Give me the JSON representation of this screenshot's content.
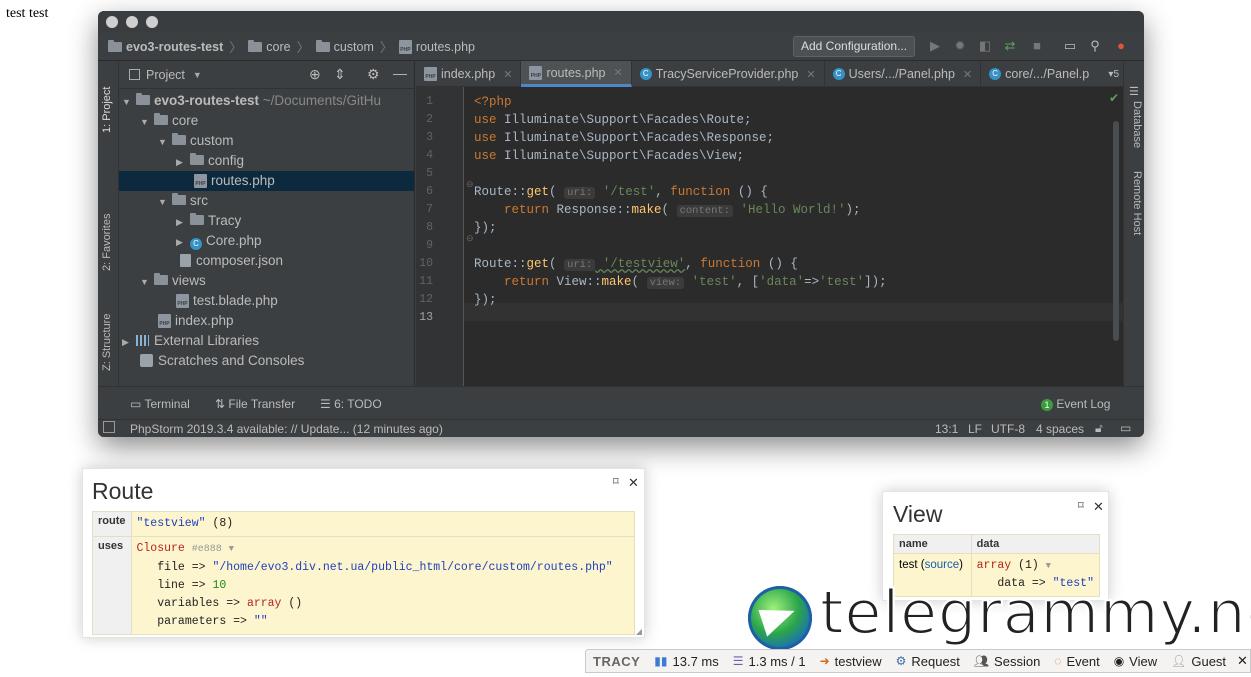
{
  "page": {
    "body_text": "test test"
  },
  "ide": {
    "nav": {
      "crumbs": [
        "evo3-routes-test",
        "core",
        "custom",
        "routes.php"
      ],
      "add_config_label": "Add Configuration..."
    },
    "left_tabs": [
      "1: Project",
      "2: Favorites",
      "Z: Structure"
    ],
    "right_tabs": [
      "Database",
      "Remote Host"
    ],
    "project": {
      "header_label": "Project",
      "tree": [
        {
          "label": "evo3-routes-test",
          "suffix": " ~/Documents/GitHu",
          "arrow": "▼",
          "icon": "folder"
        },
        {
          "label": "core",
          "arrow": "▼",
          "icon": "folder"
        },
        {
          "label": "custom",
          "arrow": "▼",
          "icon": "folder"
        },
        {
          "label": "config",
          "arrow": "▶",
          "icon": "folder"
        },
        {
          "label": "routes.php",
          "arrow": "",
          "icon": "php",
          "selected": true
        },
        {
          "label": "src",
          "arrow": "▼",
          "icon": "folder"
        },
        {
          "label": "Tracy",
          "arrow": "▶",
          "icon": "folder"
        },
        {
          "label": "Core.php",
          "arrow": "▶",
          "icon": "class"
        },
        {
          "label": "composer.json",
          "arrow": "",
          "icon": "doc"
        },
        {
          "label": "views",
          "arrow": "▼",
          "icon": "folder"
        },
        {
          "label": "test.blade.php",
          "arrow": "",
          "icon": "php"
        },
        {
          "label": "index.php",
          "arrow": "",
          "icon": "php"
        },
        {
          "label": "External Libraries",
          "arrow": "▶",
          "icon": "lib"
        },
        {
          "label": "Scratches and Consoles",
          "arrow": "",
          "icon": "scratch"
        }
      ]
    },
    "tabs": [
      {
        "label": "index.php",
        "icon": "php"
      },
      {
        "label": "routes.php",
        "icon": "php",
        "active": true
      },
      {
        "label": "TracyServiceProvider.php",
        "icon": "class"
      },
      {
        "label": "Users/.../Panel.php",
        "icon": "class"
      },
      {
        "label": "core/.../Panel.p",
        "icon": "class"
      }
    ],
    "tabs_overflow": "5",
    "line_numbers": [
      "1",
      "2",
      "3",
      "4",
      "5",
      "6",
      "7",
      "8",
      "9",
      "10",
      "11",
      "12",
      "13"
    ],
    "code": {
      "l1": "<?php",
      "l2_kw": "use",
      "l2": " Illuminate\\Support\\Facades\\Route;",
      "l3_kw": "use",
      "l3": " Illuminate\\Support\\Facades\\Response;",
      "l4_kw": "use",
      "l4": " Illuminate\\Support\\Facades\\View;",
      "l6_a": "Route::",
      "l6_fn": "get",
      "l6_b": "( ",
      "l6_hint": "uri:",
      "l6_str": " '/test'",
      "l6_c": ", ",
      "l6_kw": "function",
      "l6_d": " () {",
      "l7_kw": "    return",
      "l7_a": " Response::",
      "l7_fn": "make",
      "l7_b": "( ",
      "l7_hint": "content:",
      "l7_str": " 'Hello World!'",
      "l7_c": ");",
      "l8": "});",
      "l10_a": "Route::",
      "l10_fn": "get",
      "l10_b": "( ",
      "l10_hint": "uri:",
      "l10_str": " '/testview'",
      "l10_c": ", ",
      "l10_kw": "function",
      "l10_d": " () {",
      "l11_kw": "    return",
      "l11_a": " View::",
      "l11_fn": "make",
      "l11_b": "( ",
      "l11_hint": "view:",
      "l11_str": " 'test'",
      "l11_c": ", [",
      "l11_str2": "'data'",
      "l11_d": "=>",
      "l11_str3": "'test'",
      "l11_e": "]);",
      "l12": "});"
    },
    "bottom_tools": [
      "Terminal",
      "File Transfer",
      "6: TODO"
    ],
    "event_log": {
      "count": "1",
      "label": "Event Log"
    },
    "status": {
      "message": "PhpStorm 2019.3.4 available: // Update... (12 minutes ago)",
      "position": "13:1",
      "line_sep": "LF",
      "encoding": "UTF-8",
      "indent": "4 spaces"
    }
  },
  "route_panel": {
    "title": "Route",
    "route_label": "route",
    "route_value": "\"testview\"",
    "route_len": " (8)",
    "uses_label": "uses",
    "closure": "Closure",
    "closure_hash": "#e888",
    "file_key": "file",
    "file_value": "\"/home/evo3.div.net.ua/public_html/core/custom/routes.php\"",
    "line_key": "line",
    "line_value": "10",
    "variables_key": "variables",
    "variables_value": "array",
    "variables_suffix": " ()",
    "parameters_key": "parameters",
    "parameters_value": "\"\""
  },
  "view_panel": {
    "title": "View",
    "col_name": "name",
    "col_data": "data",
    "row_name": "test",
    "row_source": "source",
    "row_array": "array",
    "row_array_count": " (1)",
    "row_key": "data",
    "row_value": "\"test\""
  },
  "watermark": "telegrammy.net",
  "tracy_bar": {
    "logo": "TRACY",
    "time": "13.7 ms",
    "db": "1.3 ms / 1",
    "route": "testview",
    "request": "Request",
    "session": "Session",
    "event": "Event",
    "view": "View",
    "guest": "Guest"
  }
}
